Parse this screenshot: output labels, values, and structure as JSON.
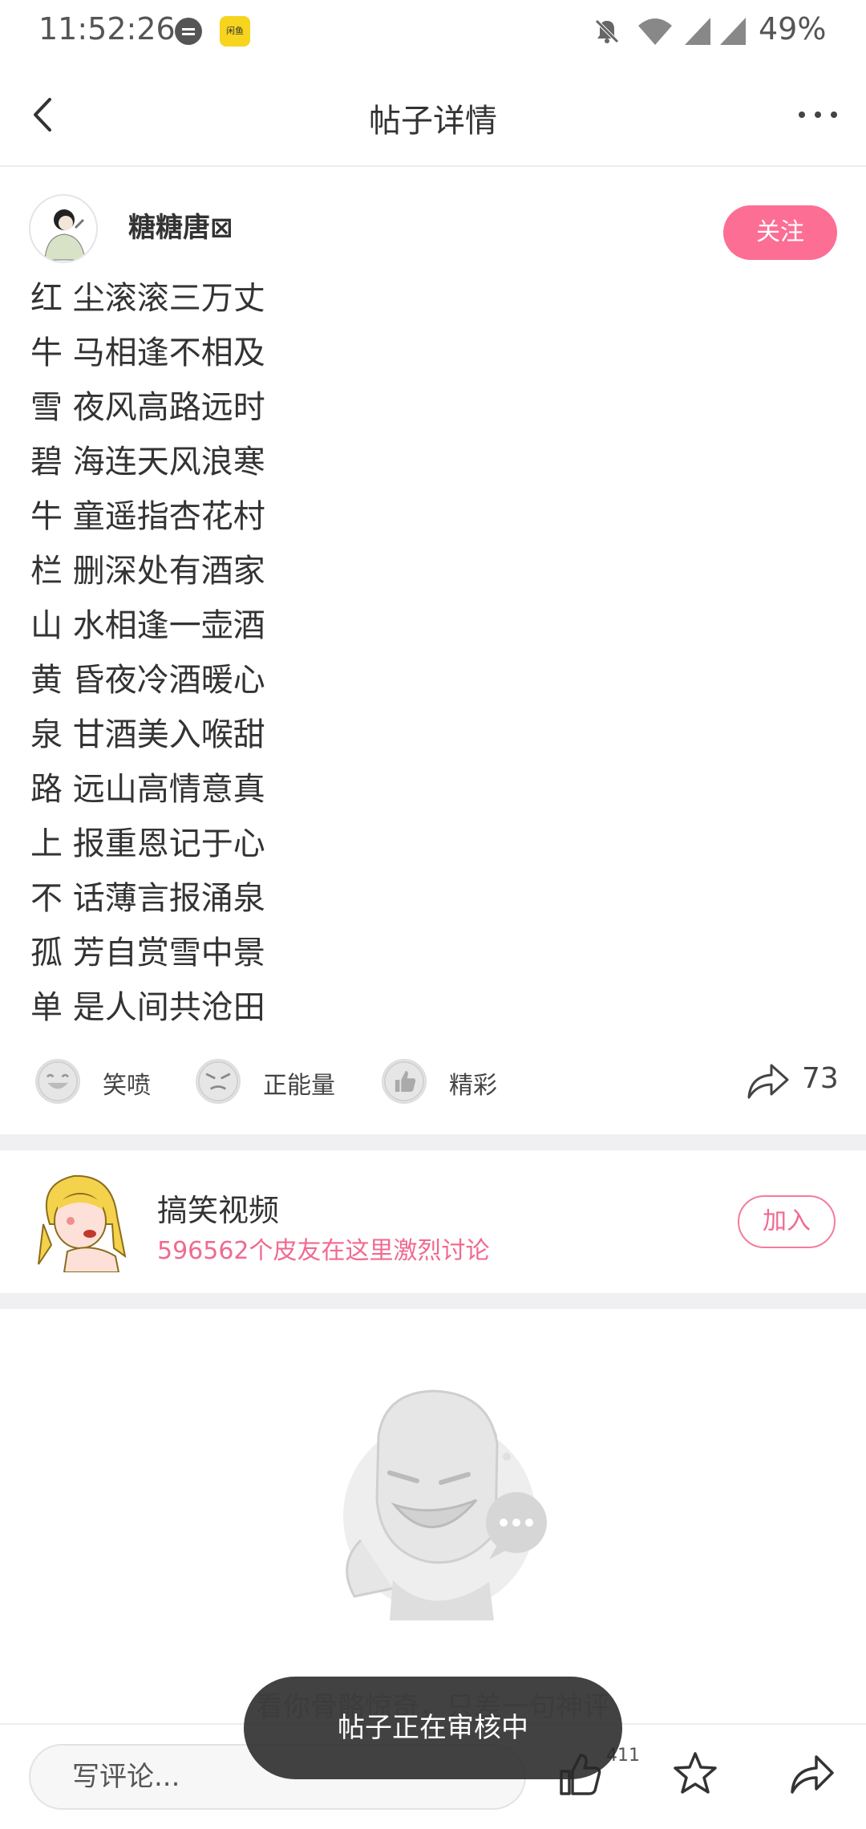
{
  "status_bar": {
    "time": "11:52:26",
    "app_icon_text": "闲鱼",
    "battery": "49%"
  },
  "header": {
    "title": "帖子详情"
  },
  "post": {
    "author_name": "糖糖唐⊠",
    "follow_label": "关注",
    "lines": [
      "红 尘滚滚三万丈",
      "牛 马相逢不相及",
      "雪 夜风高路远时",
      "碧 海连天风浪寒",
      "牛 童遥指杏花村",
      "栏 删深处有酒家",
      "山 水相逢一壶酒",
      "黄 昏夜冷酒暖心",
      "泉 甘酒美入喉甜",
      "路 远山高情意真",
      "上 报重恩记于心",
      "不 话薄言报涌泉",
      "孤 芳自赏雪中景",
      "单 是人间共沧田"
    ],
    "reactions": [
      {
        "label": "笑喷",
        "icon": "laugh-face-icon"
      },
      {
        "label": "正能量",
        "icon": "energy-face-icon"
      },
      {
        "label": "精彩",
        "icon": "thumbs-up-icon"
      }
    ],
    "share_count": "73"
  },
  "group": {
    "title": "搞笑视频",
    "subtitle": "596562个皮友在这里激烈讨论",
    "join_label": "加入"
  },
  "comments": {
    "empty_text": "看你骨骼惊奇，只差一句神评"
  },
  "toast": {
    "text": "帖子正在审核中"
  },
  "bottom_bar": {
    "comment_placeholder": "写评论...",
    "like_count": "411"
  },
  "colors": {
    "accent": "#fd6e94",
    "accent_text": "#f06a90",
    "divider": "#f0f0f2"
  }
}
